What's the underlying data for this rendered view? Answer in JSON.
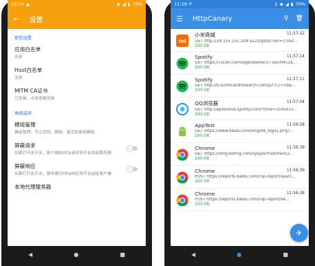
{
  "left_phone": {
    "status": {
      "time": "12:54",
      "battery": "79%"
    },
    "appbar": {
      "title": "设置"
    },
    "sections": [
      {
        "header": "抓包设置",
        "prefs": [
          {
            "title": "应用白名单",
            "summary": "全部"
          },
          {
            "title": "Host白名单",
            "summary": "全部"
          },
          {
            "title": "MITM CA证书",
            "summary": "已安装，点击查看安装"
          }
        ]
      },
      {
        "header": "高级选项",
        "prefs": [
          {
            "title": "模组管理",
            "summary": "模组管理，可以添加、删除、激活和禁用模组"
          },
          {
            "title": "屏蔽请求",
            "summary": "如果打开此开关，客户端向Http请求将不会发给服务器",
            "toggle": "off"
          },
          {
            "title": "屏蔽响应",
            "summary": "如果打开此开关，服务器对Http响应将不会返给客户端",
            "toggle": "off"
          },
          {
            "title": "本地代理服务器",
            "summary": ""
          }
        ]
      }
    ]
  },
  "right_phone": {
    "status": {
      "time": "11:59",
      "battery": "70%"
    },
    "appbar": {
      "title": "HttpCanary"
    },
    "rows": [
      {
        "app": "小米商城",
        "time": "11:57:22",
        "url": "GET http://39.155.151.208:5222/gslb/?ver=3.0&f...",
        "status": "200 OK",
        "icon": "mi-icon"
      },
      {
        "app": "Spotify",
        "time": "11:57:14",
        "url": "GET https://i.scdn.co/image/ada4bc573a03f452a...",
        "status": "200 OK",
        "icon": "spotify-icon"
      },
      {
        "app": "Spotify",
        "time": "11:57:11",
        "url": "GET http://b.scorecardresearch.com/p2?c1=19&...",
        "status": "200 OK",
        "icon": "spotify-icon"
      },
      {
        "app": "QQ浏览器",
        "time": "11:57:04",
        "url": "GET http://apresolve.spotify.com/?time=1545615...",
        "status": "200 OK",
        "icon": "qq-browser-icon"
      },
      {
        "app": "AppTest",
        "time": "11:56:58",
        "url": "GET https://www.baidu.com/img/bd_logo1.png?...",
        "status": "200 OK",
        "icon": "android-icon"
      },
      {
        "app": "Chrome",
        "time": "11:56:39",
        "url": "GET https://hmg.bdimg.com/sys/portrait/item/2...",
        "status": "200 OK",
        "icon": "chrome-icon"
      },
      {
        "app": "Chrome",
        "time": "11:56:39",
        "url": "POST https://reports.baidu.com/csp-report/searc...",
        "status": "200 OK",
        "icon": "chrome-icon"
      },
      {
        "app": "Chrome",
        "time": "11:56:38",
        "url": "POST https://reports.baidu.com/csp-report/se...",
        "status": "200 OK",
        "icon": "chrome-icon"
      }
    ]
  }
}
